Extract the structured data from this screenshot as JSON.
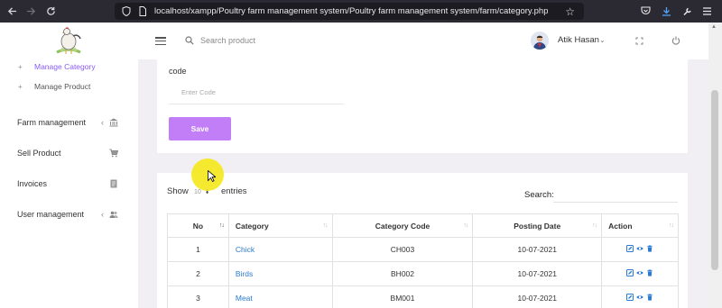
{
  "browser": {
    "url": "localhost/xampp/Poultry farm management system/Poultry farm management system/farm/category.php",
    "icons": [
      "back-icon",
      "forward-icon",
      "reload-icon",
      "shield-icon",
      "page-icon",
      "star-icon",
      "pocket-icon",
      "download-icon",
      "wrench-icon",
      "menu-icon"
    ]
  },
  "header": {
    "search_placeholder": "Search product",
    "user_name": "Atik Hasan",
    "icons": [
      "hamburger-icon",
      "search-icon",
      "fullscreen-icon",
      "power-icon"
    ]
  },
  "sidebar": {
    "sub_items": [
      {
        "label": "Manage Category",
        "active": true
      },
      {
        "label": "Manage Product",
        "active": false
      }
    ],
    "nav_items": [
      {
        "label": "Farm management",
        "icon": "bank-icon",
        "has_chevron": true
      },
      {
        "label": "Sell Product",
        "icon": "cart-icon",
        "has_chevron": false
      },
      {
        "label": "Invoices",
        "icon": "document-icon",
        "has_chevron": false
      },
      {
        "label": "User management",
        "icon": "users-icon",
        "has_chevron": true
      }
    ]
  },
  "form": {
    "code_label": "code",
    "code_placeholder": "Enter Code",
    "save_label": "Save"
  },
  "table_controls": {
    "show_label": "Show",
    "entries_value": "10",
    "entries_label": "entries",
    "search_label": "Search:"
  },
  "table": {
    "headers": [
      "No",
      "Category",
      "Category Code",
      "Posting Date",
      "Action"
    ],
    "rows": [
      {
        "no": "1",
        "category": "Chick",
        "code": "CH003",
        "date": "10-07-2021"
      },
      {
        "no": "2",
        "category": "Birds",
        "code": "BH002",
        "date": "10-07-2021"
      },
      {
        "no": "3",
        "category": "Meat",
        "code": "BM001",
        "date": "10-07-2021"
      }
    ],
    "action_icons": [
      "edit-icon",
      "view-icon",
      "delete-icon"
    ]
  },
  "colors": {
    "accent": "#c17ef7",
    "active_link": "#8a5cf5",
    "table_link": "#2a7ad1",
    "page_bg": "#f2eff4",
    "browser_bg": "#2b2a33",
    "highlight": "#f5e81e"
  }
}
